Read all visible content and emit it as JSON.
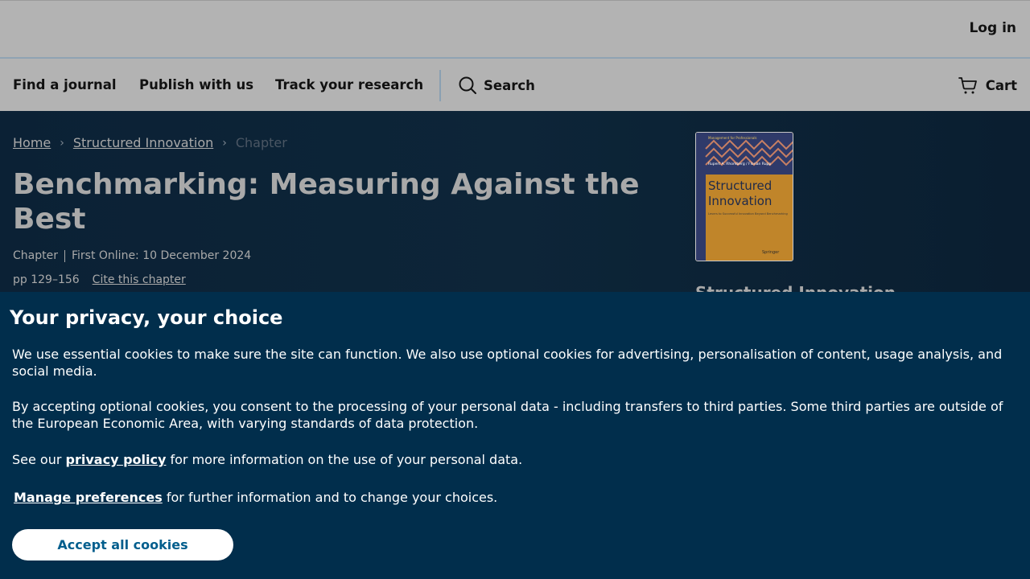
{
  "header": {
    "login_label": "Log in"
  },
  "nav": {
    "links": [
      "Find a journal",
      "Publish with us",
      "Track your research"
    ],
    "search_label": "Search",
    "cart_label": "Cart"
  },
  "breadcrumb": {
    "home": "Home",
    "book": "Structured Innovation",
    "current": "Chapter"
  },
  "chapter": {
    "title": "Benchmarking: Measuring Against the Best",
    "type": "Chapter",
    "first_online": "First Online: 10 December 2024",
    "pages": "pp 129–156",
    "cite_label": "Cite this chapter"
  },
  "book": {
    "title": "Structured Innovation",
    "cover": {
      "series": "Management for Professionals",
      "authors": "Rupert A. Rhomberg / Florian Rupp",
      "title_line1": "Structured",
      "title_line2": "Innovation",
      "subtitle": "Levers to Successful Innovation Beyond Benchmarking",
      "publisher": "Springer"
    }
  },
  "cookie": {
    "heading": "Your privacy, your choice",
    "p1": "We use essential cookies to make sure the site can function. We also use optional cookies for advertising, personalisation of content, usage analysis, and social media.",
    "p2": "By accepting optional cookies, you consent to the processing of your personal data - including transfers to third parties. Some third parties are outside of the European Economic Area, with varying standards of data protection.",
    "p3_before": "See our ",
    "privacy_link": "privacy policy",
    "p3_after": " for more information on the use of your personal data.",
    "manage_link": "Manage preferences",
    "p4_after": " for further information and to change your choices.",
    "accept_label": "Accept all cookies"
  },
  "colors": {
    "cookie_bg": "#012e4c",
    "accept_text": "#025e8d",
    "header_bg": "#b3b3b3"
  }
}
